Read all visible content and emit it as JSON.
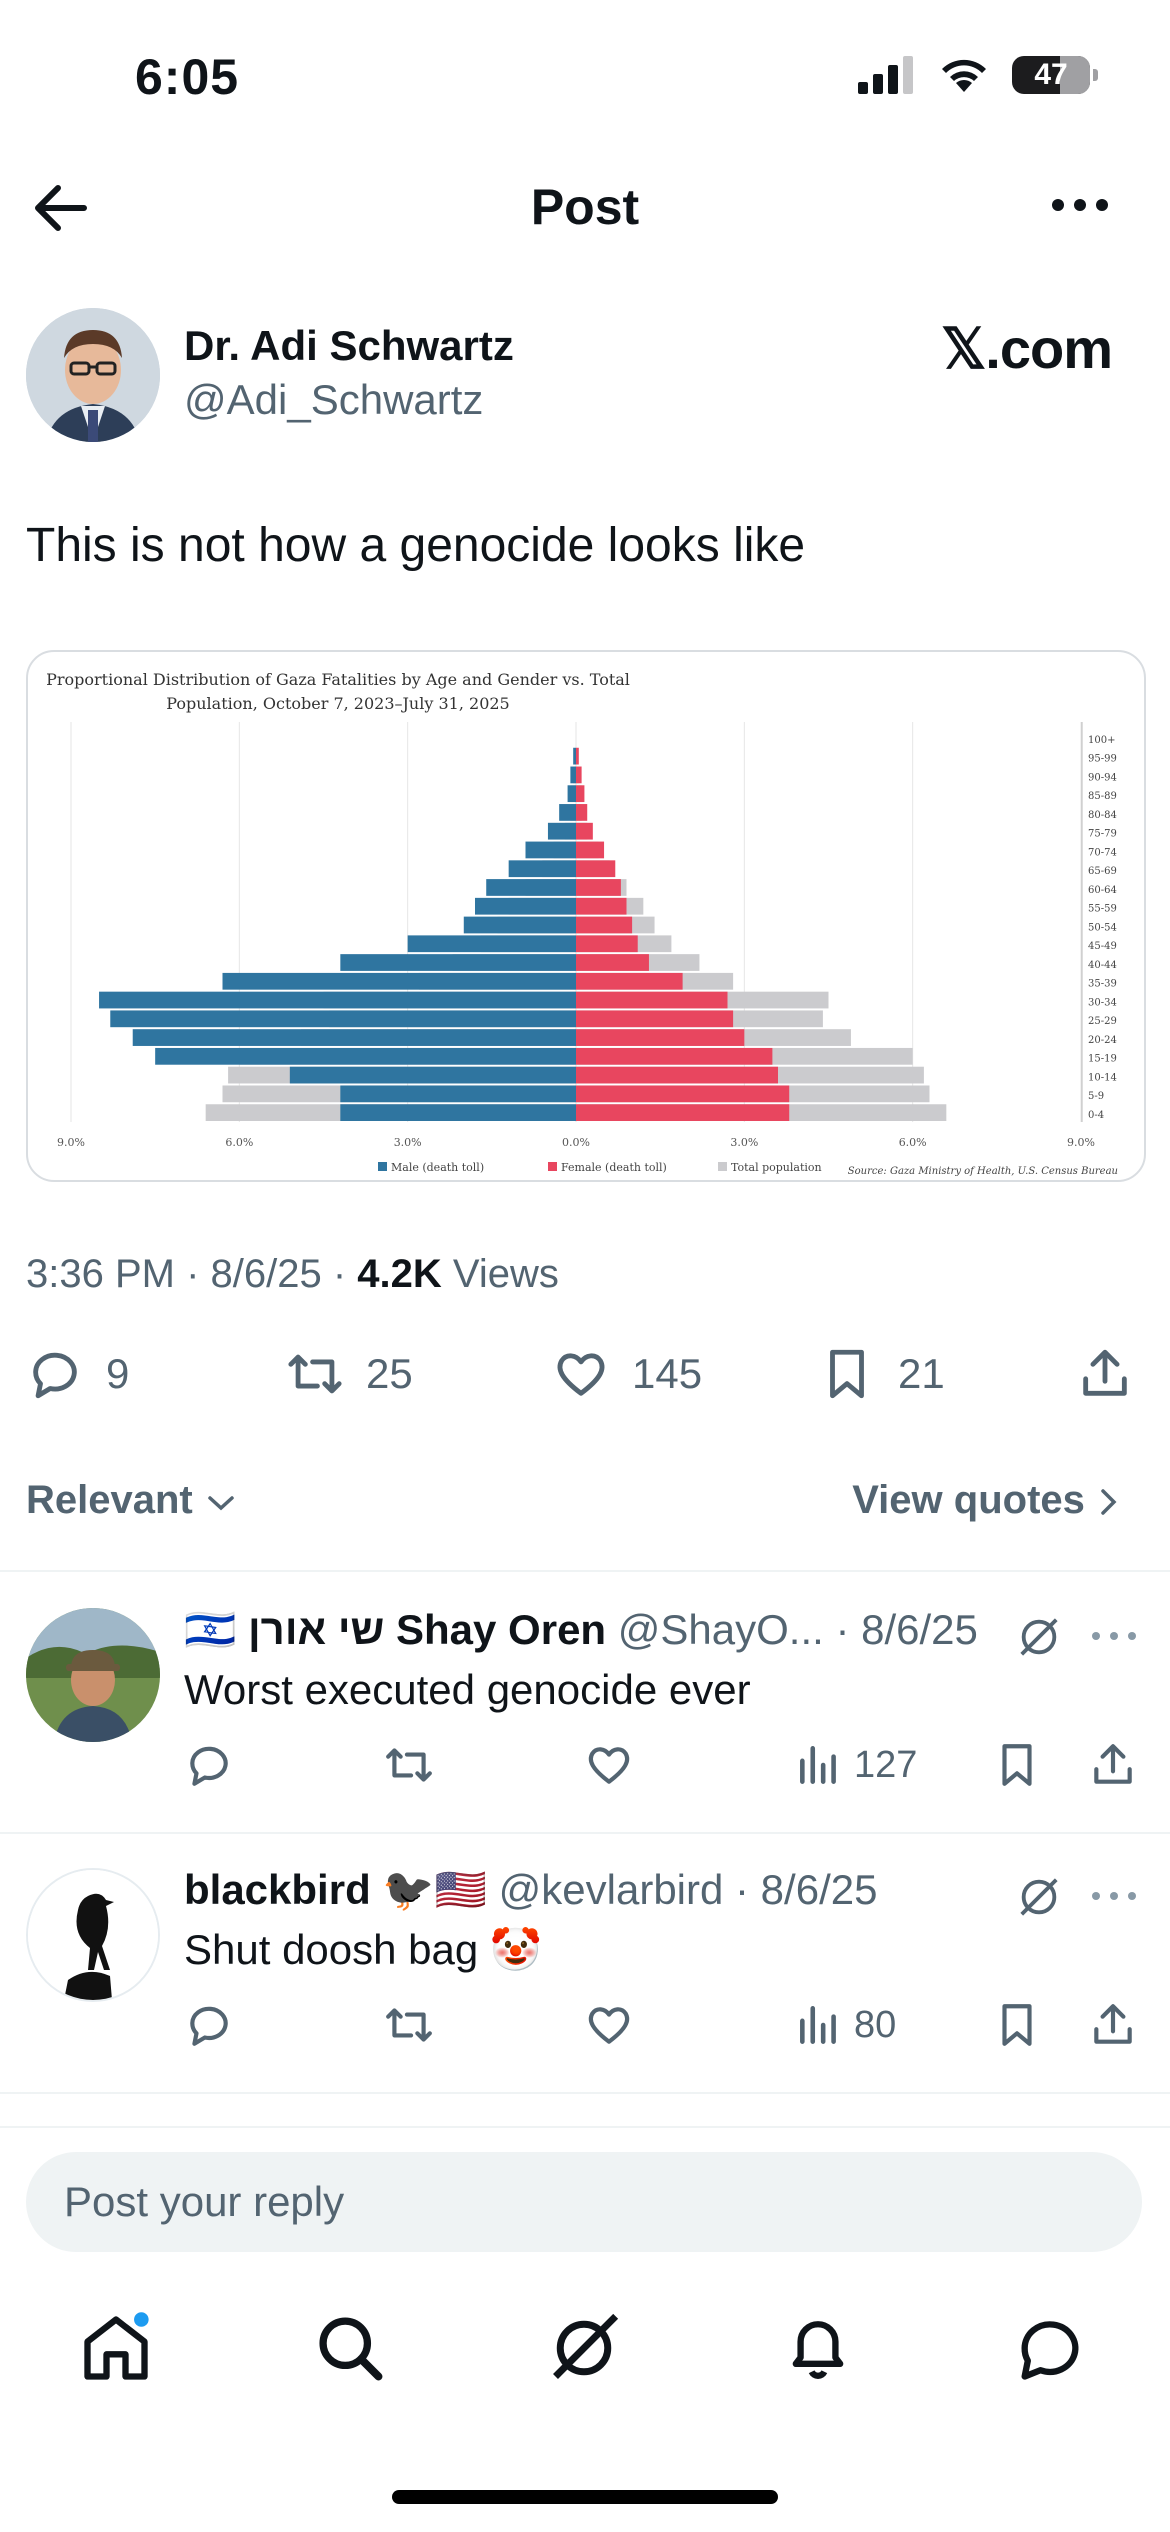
{
  "status_bar": {
    "time": "6:05",
    "battery": "47"
  },
  "header": {
    "title": "Post"
  },
  "post": {
    "author_name": "Dr. Adi Schwartz",
    "author_handle": "@Adi_Schwartz",
    "source": "𝕏.com",
    "text": "This is not how a genocide looks like",
    "time": "3:36 PM · 8/6/25 · ",
    "views_count": "4.2K",
    "views_label": " Views",
    "stats": {
      "replies": "9",
      "reposts": "25",
      "likes": "145",
      "bookmarks": "21"
    }
  },
  "chart_data": {
    "type": "bar",
    "title": "Proportional Distribution of Gaza Fatalities by Age and Gender vs. Total Population, October 7, 2023–July 31, 2025",
    "categories": [
      "100+",
      "95-99",
      "90-94",
      "85-89",
      "80-84",
      "75-79",
      "70-74",
      "65-69",
      "60-64",
      "55-59",
      "50-54",
      "45-49",
      "40-44",
      "35-39",
      "30-34",
      "25-29",
      "20-24",
      "15-19",
      "10-14",
      "5-9",
      "0-4"
    ],
    "series": [
      {
        "name": "Male (death toll)",
        "color": "#2f75a0",
        "values": [
          0.0,
          0.05,
          0.1,
          0.15,
          0.3,
          0.5,
          0.9,
          1.2,
          1.6,
          1.8,
          2.0,
          3.0,
          4.2,
          6.3,
          8.5,
          8.3,
          7.9,
          7.5,
          5.1,
          4.2,
          4.2
        ]
      },
      {
        "name": "Female (death toll)",
        "color": "#e8465f",
        "values": [
          0.0,
          0.05,
          0.1,
          0.15,
          0.2,
          0.3,
          0.5,
          0.7,
          0.8,
          0.9,
          1.0,
          1.1,
          1.3,
          1.9,
          2.7,
          2.8,
          3.0,
          3.5,
          3.6,
          3.8,
          3.8
        ]
      },
      {
        "name": "Total population",
        "color": "#cbcbce",
        "values": [
          0.0,
          0.0,
          0.05,
          0.1,
          0.1,
          0.2,
          0.4,
          0.6,
          0.9,
          1.2,
          1.4,
          1.7,
          2.2,
          2.8,
          4.5,
          4.4,
          4.9,
          6.0,
          6.2,
          6.3,
          6.6
        ]
      }
    ],
    "xticks": [
      "9.0%",
      "6.0%",
      "3.0%",
      "0.0%",
      "3.0%",
      "6.0%",
      "9.0%"
    ],
    "xlim": [
      -9,
      9
    ],
    "source_note": "Source: Gaza Ministry of Health, U.S. Census Bureau"
  },
  "filters": {
    "sort": "Relevant",
    "quotes": "View quotes"
  },
  "replies": [
    {
      "name": "🇮🇱 שי אורן Shay Oren",
      "handle": "@ShayO... · 8/6/25",
      "text": "Worst executed genocide ever",
      "views": "127"
    },
    {
      "name": "blackbird 🐦‍⬛🇺🇸",
      "handle": "@kevlarbird · 8/6/25",
      "text": "Shut doosh bag 🤡",
      "views": "80"
    }
  ],
  "reply_box": {
    "placeholder": "Post your reply"
  }
}
